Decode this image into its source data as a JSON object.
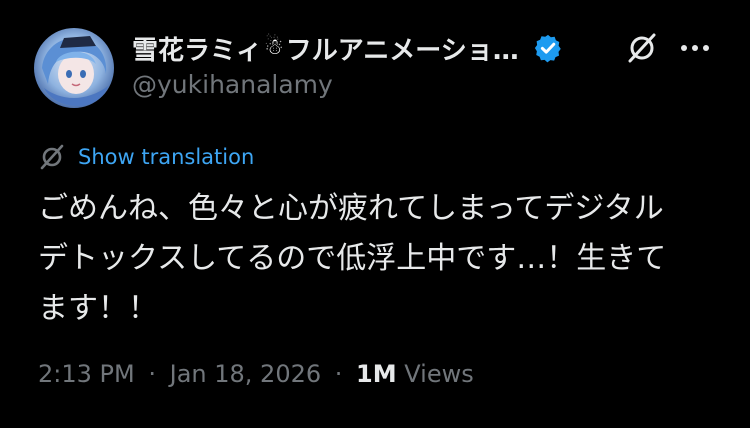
{
  "tweet": {
    "display_name": "雪花ラミィ",
    "display_name_suffix": "フルアニメーショ…",
    "handle": "@yukihanalamy",
    "emoji_icon": "snowman-icon",
    "verified_badge_color": "#1d9bf0",
    "show_translation_label": "Show translation",
    "text_lines": [
      "ごめんね、色々と心が疲れてしまってデジタル",
      "デトックスしてるので低浮上中です…！生きて",
      "ます！！"
    ],
    "time": "2:13 PM",
    "separator": "·",
    "date": "Jan 18, 2026",
    "views_count": "1M",
    "views_label": "Views"
  },
  "colors": {
    "background": "#000000",
    "primary_text": "#e7e9ea",
    "secondary_text": "#71767b",
    "link": "#3ea6f4"
  }
}
